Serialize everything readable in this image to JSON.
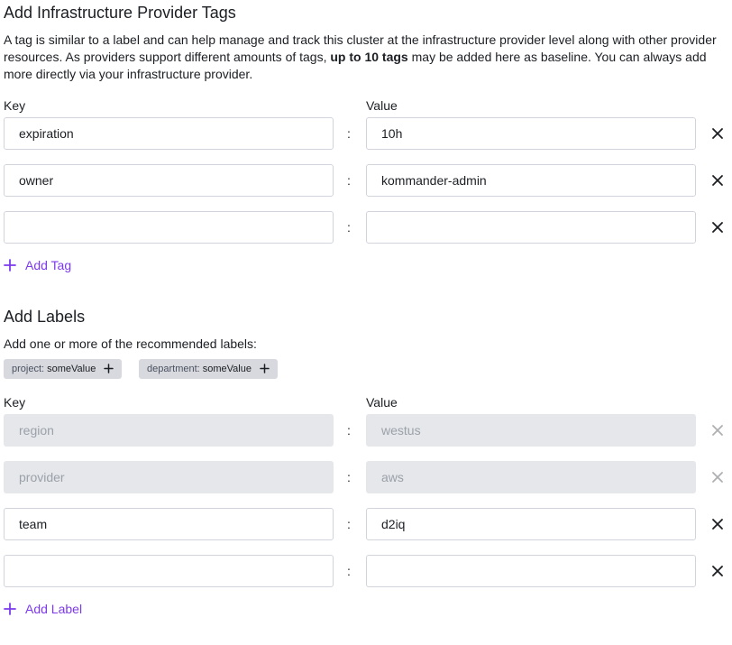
{
  "tags_section": {
    "title": "Add Infrastructure Provider Tags",
    "description_part1": "A tag is similar to a label and can help manage and track this cluster at the infrastructure provider level along with other provider resources. As providers support different amounts of tags, ",
    "description_bold": "up to 10 tags",
    "description_part2": " may be added here as baseline. You can always add more directly via your infrastructure provider.",
    "key_label": "Key",
    "value_label": "Value",
    "rows": [
      {
        "key": "expiration",
        "value": "10h"
      },
      {
        "key": "owner",
        "value": "kommander-admin"
      },
      {
        "key": "",
        "value": ""
      }
    ],
    "add_label": "Add Tag"
  },
  "labels_section": {
    "title": "Add Labels",
    "recommend_text": "Add one or more of the recommended labels:",
    "chips": [
      {
        "key": "project:",
        "value": "someValue"
      },
      {
        "key": "department:",
        "value": "someValue"
      }
    ],
    "key_label": "Key",
    "value_label": "Value",
    "rows": [
      {
        "key": "region",
        "value": "westus",
        "disabled": true
      },
      {
        "key": "provider",
        "value": "aws",
        "disabled": true
      },
      {
        "key": "team",
        "value": "d2iq",
        "disabled": false
      },
      {
        "key": "",
        "value": "",
        "disabled": false
      }
    ],
    "add_label": "Add Label"
  },
  "separator": ":",
  "colors": {
    "accent": "#7c3aed",
    "disabled_bg": "#e6e7ea",
    "chip_bg": "#d7d9de"
  }
}
